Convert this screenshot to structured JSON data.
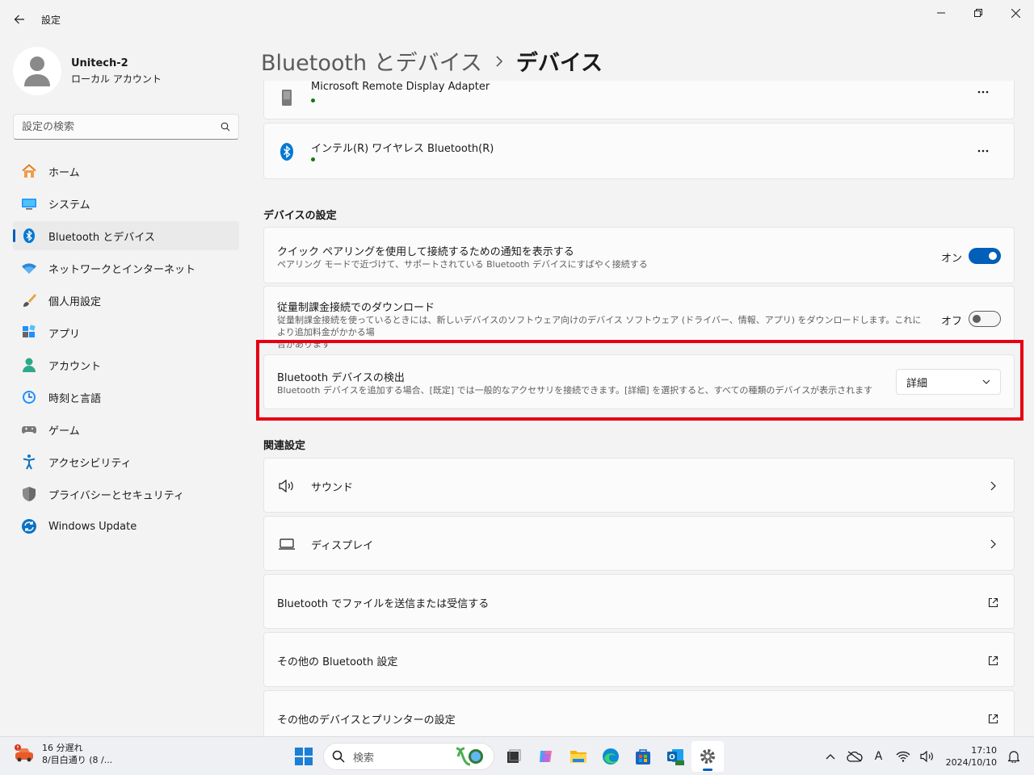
{
  "window": {
    "title": "設定"
  },
  "profile": {
    "name": "Unitech-2",
    "account_type": "ローカル アカウント"
  },
  "search": {
    "placeholder": "設定の検索"
  },
  "sidebar": {
    "items": [
      {
        "label": "ホーム",
        "icon": "home-icon"
      },
      {
        "label": "システム",
        "icon": "system-icon"
      },
      {
        "label": "Bluetooth とデバイス",
        "icon": "bluetooth-icon",
        "active": true
      },
      {
        "label": "ネットワークとインターネット",
        "icon": "wifi-icon"
      },
      {
        "label": "個人用設定",
        "icon": "brush-icon"
      },
      {
        "label": "アプリ",
        "icon": "apps-icon"
      },
      {
        "label": "アカウント",
        "icon": "account-icon"
      },
      {
        "label": "時刻と言語",
        "icon": "time-language-icon"
      },
      {
        "label": "ゲーム",
        "icon": "gamepad-icon"
      },
      {
        "label": "アクセシビリティ",
        "icon": "accessibility-icon"
      },
      {
        "label": "プライバシーとセキュリティ",
        "icon": "shield-icon"
      },
      {
        "label": "Windows Update",
        "icon": "update-icon"
      }
    ]
  },
  "breadcrumb": {
    "parent": "Bluetooth とデバイス",
    "current": "デバイス"
  },
  "devices": [
    {
      "name": "Microsoft Remote Display Adapter",
      "icon": "display-adapter-icon"
    },
    {
      "name": "インテル(R) ワイヤレス Bluetooth(R)",
      "icon": "bluetooth-icon"
    }
  ],
  "device_settings": {
    "header": "デバイスの設定",
    "swift_pair": {
      "title": "クイック ペアリングを使用して接続するための通知を表示する",
      "desc": "ペアリング モードで近づけて、サポートされている Bluetooth デバイスにすばやく接続する",
      "state_label": "オン",
      "enabled": true
    },
    "metered": {
      "title": "従量制課金接続でのダウンロード",
      "desc_line1": "従量制課金接続を使っているときには、新しいデバイスのソフトウェア向けのデバイス ソフトウェア (ドライバー、情報、アプリ) をダウンロードします。これにより追加料金がかかる場",
      "desc_line2": "合があります",
      "state_label": "オフ",
      "enabled": false
    },
    "discovery": {
      "title": "Bluetooth デバイスの検出",
      "desc": "Bluetooth デバイスを追加する場合、[既定] では一般的なアクセサリを接続できます。[詳細] を選択すると、すべての種類のデバイスが表示されます",
      "selected": "詳細"
    }
  },
  "related": {
    "header": "関連設定",
    "items": [
      {
        "label": "サウンド",
        "icon": "speaker-icon",
        "kind": "chevron"
      },
      {
        "label": "ディスプレイ",
        "icon": "laptop-icon",
        "kind": "chevron"
      },
      {
        "label": "Bluetooth でファイルを送信または受信する",
        "kind": "external"
      },
      {
        "label": "その他の Bluetooth 設定",
        "kind": "external"
      },
      {
        "label": "その他のデバイスとプリンターの設定",
        "kind": "external"
      }
    ]
  },
  "taskbar": {
    "weather_line1": "16 分遅れ",
    "weather_line2": "8/目白通り (8 /...",
    "search_placeholder": "検索",
    "time": "17:10",
    "date": "2024/10/10",
    "ime": "A"
  },
  "colors": {
    "accent": "#005fb8",
    "highlight": "#e60012",
    "status_green": "#0f7b0f"
  }
}
